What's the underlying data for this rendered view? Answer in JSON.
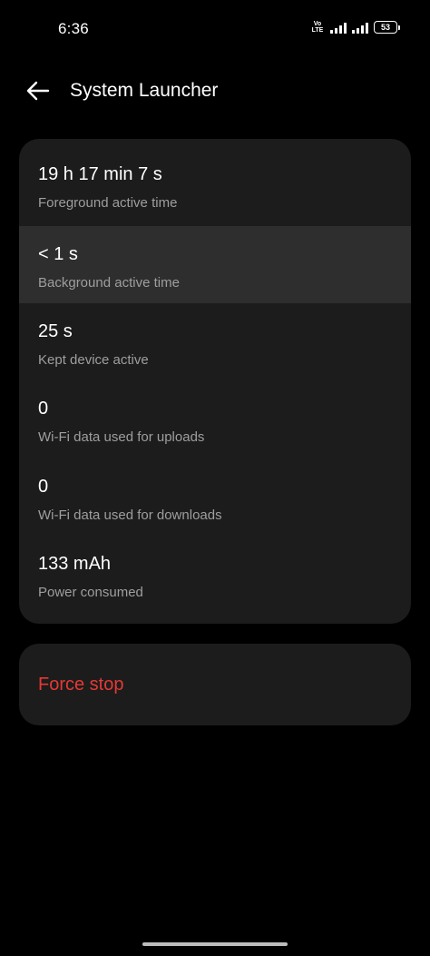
{
  "status_bar": {
    "time": "6:36",
    "volte_top": "Vo",
    "volte_bottom": "LTE",
    "battery": "53"
  },
  "header": {
    "back_icon": "arrow-left-icon",
    "title": "System Launcher"
  },
  "stats": [
    {
      "value": "19 h 17 min 7 s",
      "label": "Foreground active time"
    },
    {
      "value": "< 1 s",
      "label": "Background active time"
    },
    {
      "value": "25 s",
      "label": "Kept device active"
    },
    {
      "value": "0",
      "label": "Wi-Fi data used for uploads"
    },
    {
      "value": "0",
      "label": "Wi-Fi data used for downloads"
    },
    {
      "value": "133 mAh",
      "label": "Power consumed"
    }
  ],
  "actions": {
    "force_stop": "Force stop"
  },
  "colors": {
    "background": "#000000",
    "card": "#1c1c1c",
    "highlight": "#2e2e2e",
    "danger": "#e53935",
    "secondary_text": "#9e9e9e"
  }
}
